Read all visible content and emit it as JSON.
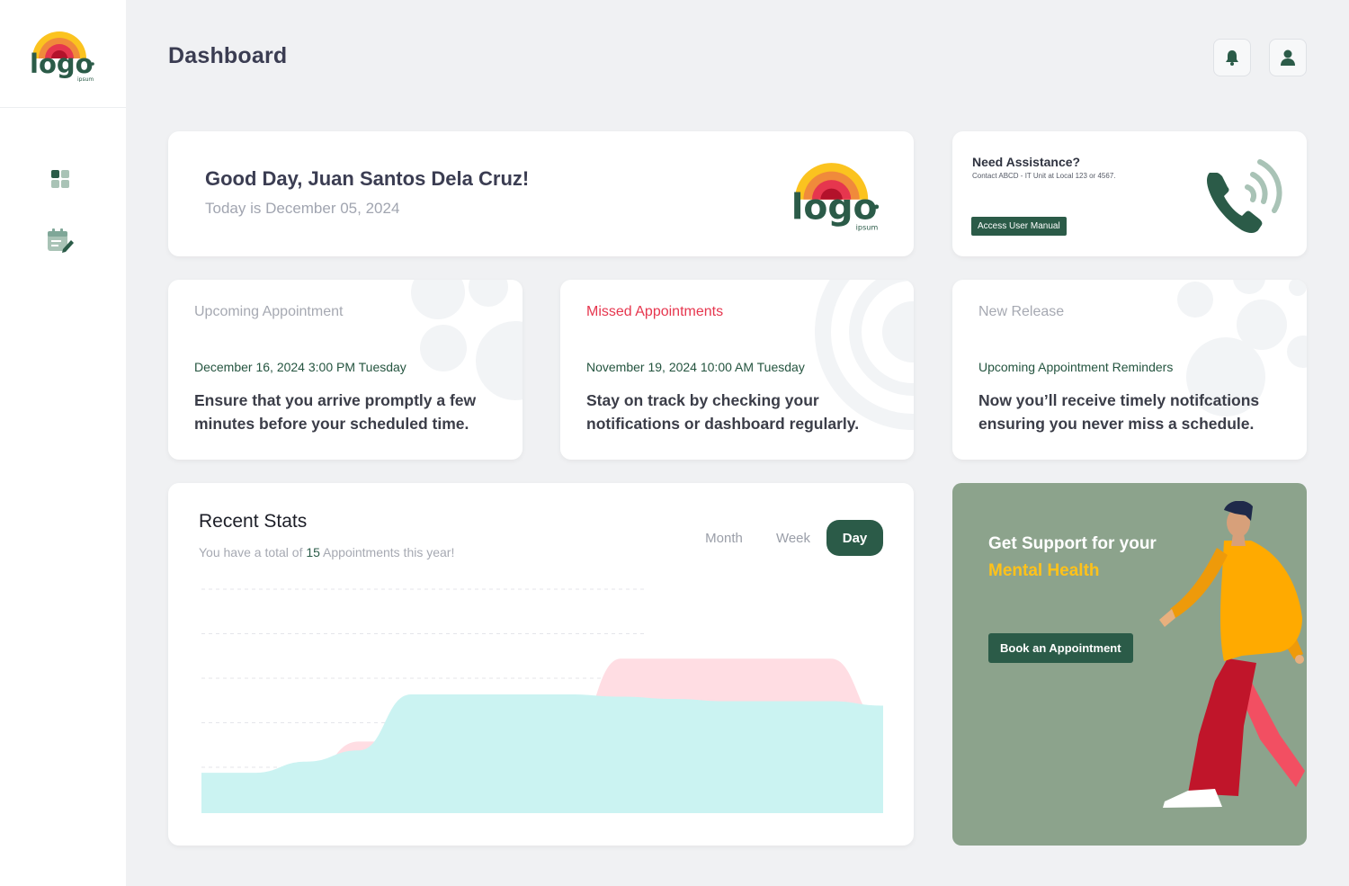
{
  "brand": {
    "logo_text": "logo",
    "logo_sub": "ipsum"
  },
  "header": {
    "title": "Dashboard"
  },
  "sidebar": {
    "items": [
      {
        "icon": "dashboard-icon"
      },
      {
        "icon": "calendar-edit-icon"
      }
    ]
  },
  "greeting": {
    "title": "Good Day, Juan Santos Dela Cruz!",
    "date": "Today is December 05, 2024"
  },
  "assistance": {
    "title": "Need Assistance?",
    "subtitle": "Contact ABCD - IT Unit at Local 123 or 4567.",
    "button": "Access User Manual"
  },
  "cards": [
    {
      "label": "Upcoming Appointment",
      "date": "December 16, 2024 3:00 PM Tuesday",
      "body": "Ensure that you arrive promptly a few minutes before your scheduled time."
    },
    {
      "label": "Missed Appointments",
      "date": "November 19, 2024 10:00 AM Tuesday",
      "body": "Stay on track by checking your notifications or dashboard regularly."
    },
    {
      "label": "New Release",
      "date": "Upcoming Appointment Reminders",
      "body": "Now you’ll receive timely notifcations ensuring you never miss a schedule."
    }
  ],
  "stats": {
    "title": "Recent Stats",
    "sub_prefix": "You have a total of ",
    "count": "15",
    "sub_suffix": " Appointments this year!",
    "tabs": [
      "Month",
      "Week",
      "Day"
    ],
    "active_tab": "Day"
  },
  "chart_data": {
    "type": "area",
    "grid": true,
    "ylim": [
      0,
      10
    ],
    "x": [
      0,
      1,
      2,
      3,
      4,
      5,
      6,
      7,
      8,
      9,
      10,
      11,
      12,
      13
    ],
    "series": [
      {
        "color": "#ffdde3",
        "values": [
          0.8,
          0.8,
          1.6,
          3.2,
          3.2,
          3.2,
          3.2,
          3.2,
          6.9,
          6.9,
          6.9,
          6.9,
          6.9,
          4.0
        ]
      },
      {
        "color": "#cbf3f2",
        "values": [
          1.8,
          1.8,
          2.3,
          2.8,
          5.3,
          5.3,
          5.3,
          5.3,
          5.2,
          5.1,
          5.0,
          5.0,
          5.0,
          4.8
        ]
      }
    ]
  },
  "promo": {
    "line1": "Get Support for your",
    "line2": "Mental Health",
    "button": "Book an Appointment"
  },
  "colors": {
    "primary": "#2b5b48",
    "accent_red": "#e6364e",
    "promo_bg": "#8ca38c",
    "promo_yellow": "#ffc21a"
  }
}
